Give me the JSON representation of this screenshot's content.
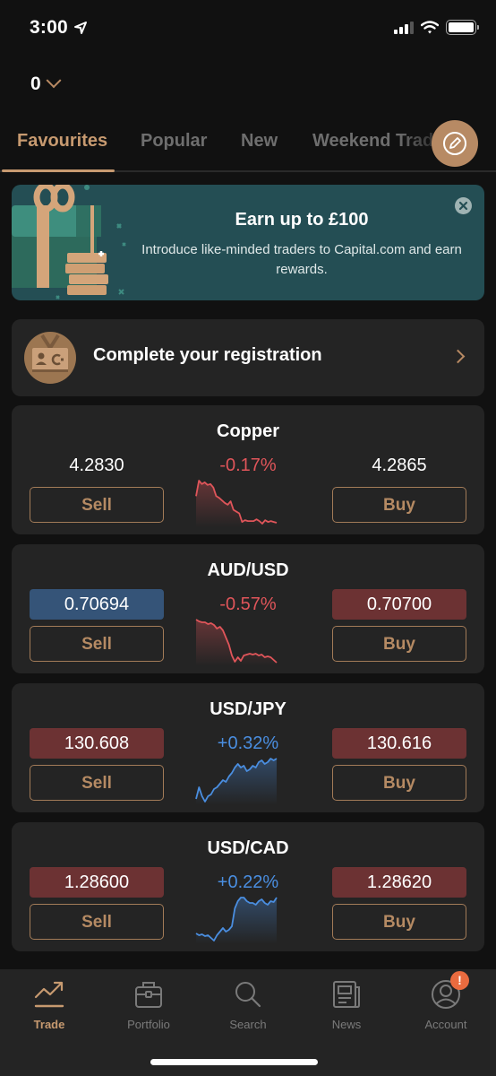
{
  "status_bar": {
    "time": "3:00",
    "location_icon": "location-arrow-icon",
    "signal_icon": "cellular-signal-icon",
    "wifi_icon": "wifi-icon",
    "battery_icon": "battery-icon"
  },
  "account": {
    "value": "0",
    "chevron_icon": "chevron-down-icon"
  },
  "tabs": [
    {
      "label": "Favourites",
      "active": true
    },
    {
      "label": "Popular",
      "active": false
    },
    {
      "label": "New",
      "active": false
    },
    {
      "label": "Weekend Trading",
      "active": false
    }
  ],
  "edit_button_icon": "pencil-icon",
  "promo": {
    "title": "Earn up to £100",
    "text": "Introduce like-minded traders to Capital.com and earn rewards.",
    "close_icon": "close-icon",
    "art_icon": "gift-coins-icon"
  },
  "registration": {
    "label": "Complete your registration",
    "icon": "id-card-icon",
    "chevron_icon": "chevron-right-icon"
  },
  "instruments": [
    {
      "name": "Copper",
      "sell_price": "4.2830",
      "buy_price": "4.2865",
      "sell_state": "neutral",
      "buy_state": "neutral",
      "change": "-0.17%",
      "direction": "down",
      "sell_label": "Sell",
      "buy_label": "Buy",
      "sparkline": [
        30,
        48,
        44,
        46,
        43,
        44,
        40,
        30,
        28,
        25,
        22,
        20,
        24,
        14,
        12,
        10,
        0,
        2,
        1,
        1,
        1,
        3,
        1,
        -2,
        2,
        0,
        1,
        0,
        -1
      ]
    },
    {
      "name": "AUD/USD",
      "sell_price": "0.70694",
      "buy_price": "0.70700",
      "sell_state": "up",
      "buy_state": "down",
      "change": "-0.57%",
      "direction": "down",
      "sell_label": "Sell",
      "buy_label": "Buy",
      "sparkline": [
        48,
        46,
        45,
        45,
        43,
        44,
        42,
        38,
        40,
        36,
        28,
        20,
        8,
        1,
        6,
        2,
        8,
        9,
        10,
        9,
        10,
        8,
        9,
        6,
        7,
        6,
        3,
        0
      ]
    },
    {
      "name": "USD/JPY",
      "sell_price": "130.608",
      "buy_price": "130.616",
      "sell_state": "down",
      "buy_state": "down",
      "change": "+0.32%",
      "direction": "up",
      "sell_label": "Sell",
      "buy_label": "Buy",
      "sparkline": [
        5,
        18,
        8,
        2,
        8,
        10,
        16,
        18,
        22,
        26,
        24,
        30,
        34,
        40,
        44,
        40,
        42,
        36,
        38,
        42,
        40,
        46,
        48,
        44,
        46,
        50,
        48,
        50
      ]
    },
    {
      "name": "USD/CAD",
      "sell_price": "1.28600",
      "buy_price": "1.28620",
      "sell_state": "down",
      "buy_state": "down",
      "change": "+0.22%",
      "direction": "up",
      "sell_label": "Sell",
      "buy_label": "Buy",
      "sparkline": [
        8,
        6,
        7,
        5,
        6,
        3,
        0,
        6,
        10,
        14,
        10,
        12,
        16,
        36,
        44,
        48,
        48,
        44,
        42,
        42,
        40,
        44,
        46,
        42,
        40,
        44,
        43,
        48
      ]
    }
  ],
  "colors": {
    "accent": "#c79a70",
    "down": "#e0555a",
    "up": "#4a8ee0",
    "bid_up_bg": "#355478",
    "bid_down_bg": "#6c3233",
    "badge": "#ea6b3f"
  },
  "bottom_nav": [
    {
      "label": "Trade",
      "icon": "trend-chart-icon",
      "active": true
    },
    {
      "label": "Portfolio",
      "icon": "briefcase-icon",
      "active": false
    },
    {
      "label": "Search",
      "icon": "search-icon",
      "active": false
    },
    {
      "label": "News",
      "icon": "newspaper-icon",
      "active": false
    },
    {
      "label": "Account",
      "icon": "account-icon",
      "active": false,
      "badge": "!"
    }
  ]
}
